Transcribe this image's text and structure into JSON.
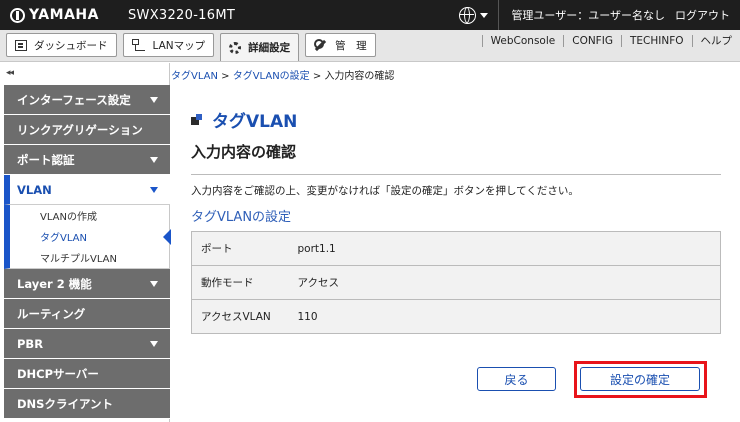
{
  "topbar": {
    "brand": "YAMAHA",
    "model": "SWX3220-16MT",
    "user": "管理ユーザー：ユーザー名なし",
    "logout": "ログアウト"
  },
  "navbar": {
    "tabs": [
      {
        "label": "ダッシュボード",
        "icon": "dashboard-icon"
      },
      {
        "label": "LANマップ",
        "icon": "lan-map-icon"
      },
      {
        "label": "詳細設定",
        "icon": "gear-icon",
        "active": true
      },
      {
        "label": "管　理",
        "icon": "wrench-icon"
      }
    ],
    "links": [
      "WebConsole",
      "CONFIG",
      "TECHINFO",
      "ヘルプ"
    ]
  },
  "sidebar": {
    "collapse": "◂◂",
    "items": [
      {
        "label": "インターフェース設定",
        "expandable": true
      },
      {
        "label": "リンクアグリゲーション",
        "expandable": false
      },
      {
        "label": "ポート認証",
        "expandable": true
      },
      {
        "label": "VLAN",
        "expandable": true,
        "active": true
      },
      {
        "label": "Layer 2 機能",
        "expandable": true
      },
      {
        "label": "ルーティング",
        "expandable": false
      },
      {
        "label": "PBR",
        "expandable": true
      },
      {
        "label": "DHCPサーバー",
        "expandable": false
      },
      {
        "label": "DNSクライアント",
        "expandable": false
      }
    ],
    "vlan_sub": [
      "VLANの作成",
      "タグVLAN",
      "マルチプルVLAN"
    ]
  },
  "breadcrumb": {
    "items": [
      "タグVLAN",
      "タグVLANの設定",
      "入力内容の確認"
    ],
    "separator": " > "
  },
  "main": {
    "title": "タグVLAN",
    "section_title": "入力内容の確認",
    "instruction": "入力内容をご確認の上、変更がなければ「設定の確定」ボタンを押してください。",
    "sub_title": "タグVLANの設定",
    "rows": [
      {
        "key": "ポート",
        "value": "port1.1"
      },
      {
        "key": "動作モード",
        "value": "アクセス"
      },
      {
        "key": "アクセスVLAN",
        "value": "110"
      }
    ],
    "back_label": "戻る",
    "confirm_label": "設定の確定"
  },
  "colors": {
    "accent": "#1a4fb0",
    "highlight": "#e8141a",
    "sidebar": "#6d6d6d",
    "topbar": "#1e1e1e"
  }
}
